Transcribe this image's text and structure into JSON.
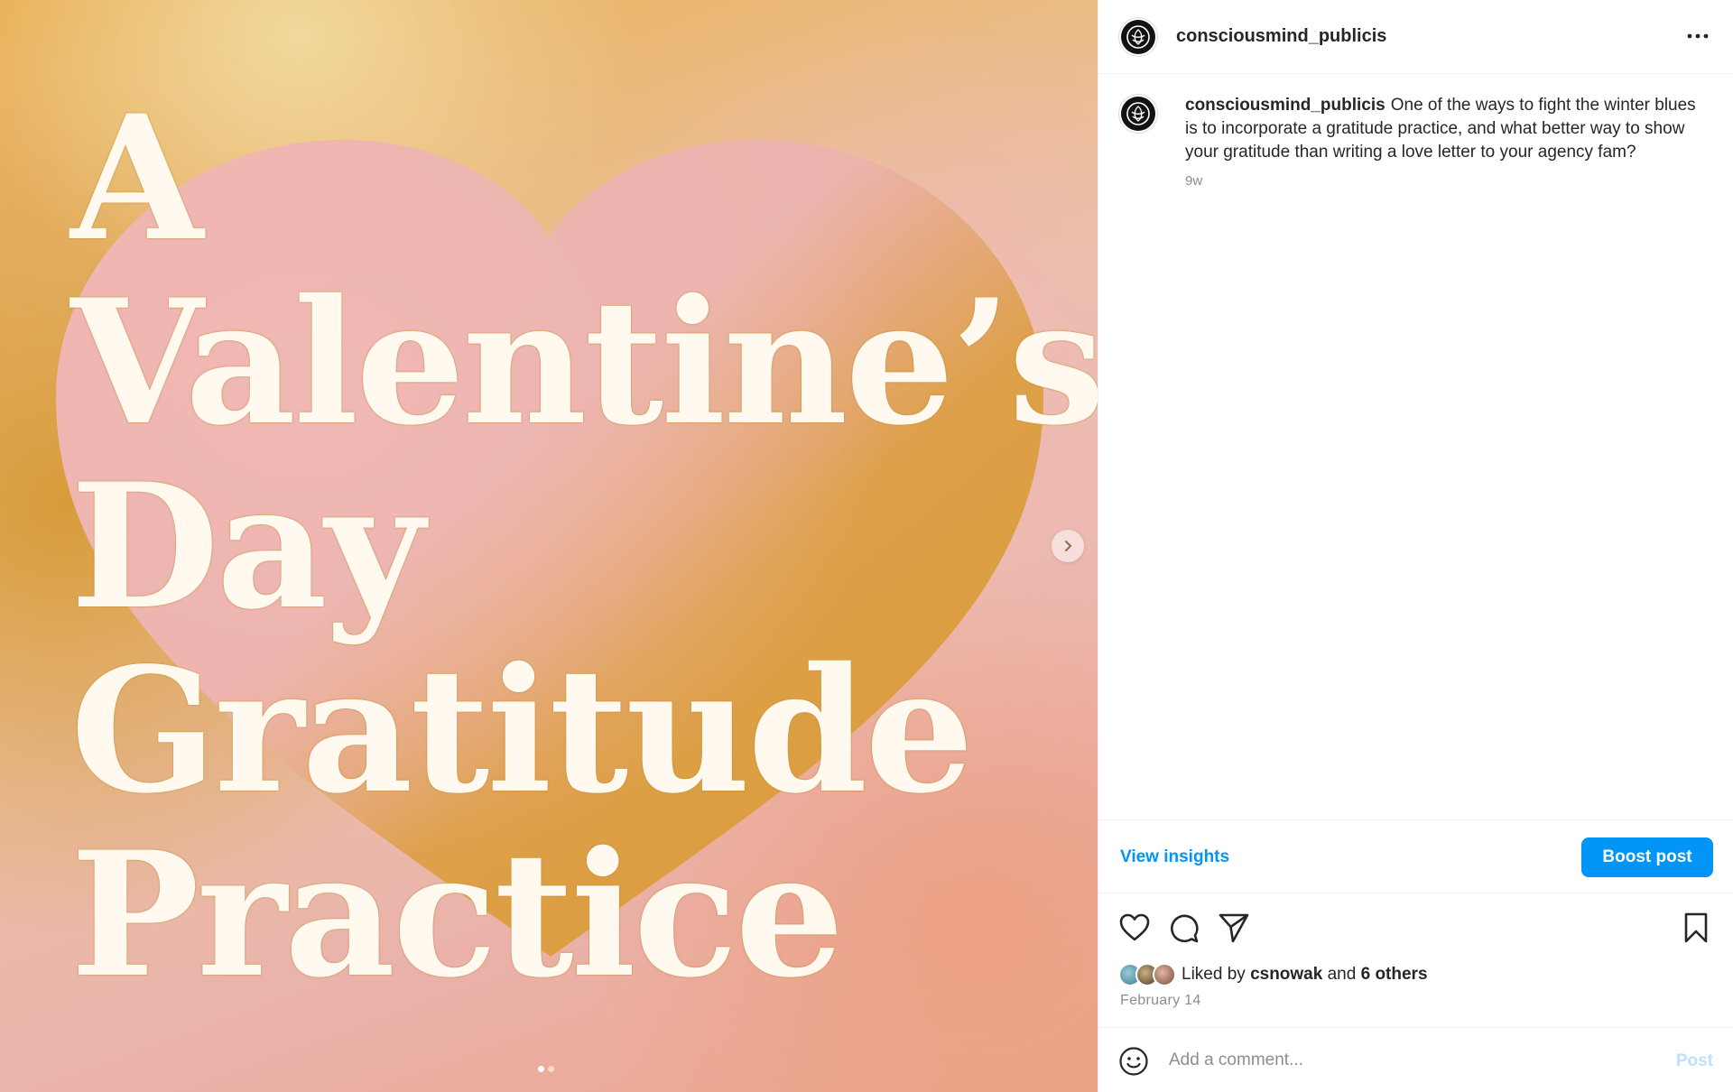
{
  "post": {
    "username": "consciousmind_publicis",
    "caption": "One of the ways to fight the winter blues is to incorporate a gratitude practice, and what better way to show your gratitude than writing a love letter to your agency fam?",
    "time_ago": "9w",
    "date": "February 14"
  },
  "media": {
    "title_lines": [
      "A",
      "Valentine’s",
      "Day",
      "Gratitude",
      "Practice"
    ],
    "carousel_current": 1,
    "carousel_total": 2,
    "colors": {
      "mustard": "#d99a32",
      "pink": "#ecb4b0",
      "cream": "#fff9f0"
    }
  },
  "insights": {
    "view_label": "View insights",
    "boost_label": "Boost post"
  },
  "likes": {
    "prefix": "Liked by",
    "user": "csnowak",
    "joiner": "and",
    "others": "6 others"
  },
  "comment": {
    "placeholder": "Add a comment...",
    "post_label": "Post"
  },
  "icons": [
    "more-icon",
    "heart-icon",
    "comment-icon",
    "share-icon",
    "bookmark-icon",
    "emoji-icon",
    "chevron-right-icon"
  ],
  "theme": {
    "accent": "#0095f6",
    "text": "#262626",
    "muted": "#8e8e8e",
    "border": "#efefef"
  }
}
